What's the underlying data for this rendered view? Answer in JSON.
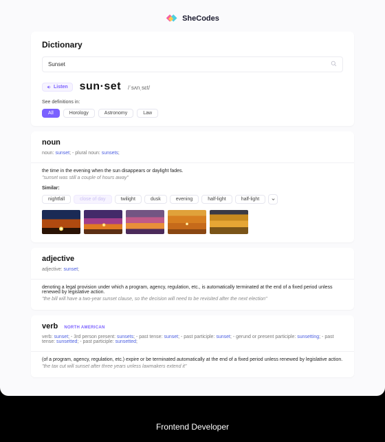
{
  "brand": {
    "name": "SheCodes"
  },
  "header": {
    "title": "Dictionary",
    "search_value": "Sunset",
    "listen_label": "Listen",
    "word": "sun·set",
    "phonetic": "/ˈsʌnˌsɛt/",
    "see_definitions_label": "See definitions in:",
    "categories": [
      "All",
      "Horology",
      "Astronomy",
      "Law"
    ],
    "active_category_index": 0
  },
  "entries": {
    "noun": {
      "pos": "noun",
      "grammar_parts": [
        {
          "plain": "noun: "
        },
        {
          "kw": "sunset"
        },
        {
          "plain": ";   -   plural noun: "
        },
        {
          "kw": "sunsets"
        },
        {
          "plain": ";"
        }
      ],
      "definition": "the time in the evening when the sun disappears or daylight fades.",
      "example": "\"sunset was still a couple of hours away\"",
      "similar_label": "Similar:",
      "similar": [
        "nightfall",
        "close of day",
        "twilight",
        "dusk",
        "evening",
        "half-light",
        "half-light"
      ]
    },
    "adjective": {
      "pos": "adjective",
      "grammar_parts": [
        {
          "plain": "adjective: "
        },
        {
          "kw": "sunset"
        },
        {
          "plain": ";"
        }
      ],
      "definition": "denoting a legal provision under which a program, agency, regulation, etc., is automatically terminated at the end of a fixed period unless renewed by legislative action.",
      "example": "\"the bill will have a two-year sunset clause, so the decision will need to be revisited after the next election\""
    },
    "verb": {
      "pos": "verb",
      "tag": "NORTH AMERICAN",
      "grammar_parts": [
        {
          "plain": "verb: "
        },
        {
          "kw": "sunset"
        },
        {
          "plain": ";   -   3rd person present: "
        },
        {
          "kw": "sunsets"
        },
        {
          "plain": ";   -   past tense: "
        },
        {
          "kw": "sunset"
        },
        {
          "plain": ";   -   past participle: "
        },
        {
          "kw": "sunset"
        },
        {
          "plain": ";   -   gerund or present participle: "
        },
        {
          "kw": "sunsetting"
        },
        {
          "plain": ";   -   past tense: "
        },
        {
          "kw": "sunsetted"
        },
        {
          "plain": ";   -   past participle: "
        },
        {
          "kw": "sunsetted"
        },
        {
          "plain": ";"
        }
      ],
      "definition": "(of a program, agency, regulation, etc.) expire or be terminated automatically at the end of a fixed period unless renewed by legislative action.",
      "example": "\"the tax cut will sunset after three years unless lawmakers extend it\""
    }
  },
  "footer": {
    "text": "Frontend Developer"
  }
}
